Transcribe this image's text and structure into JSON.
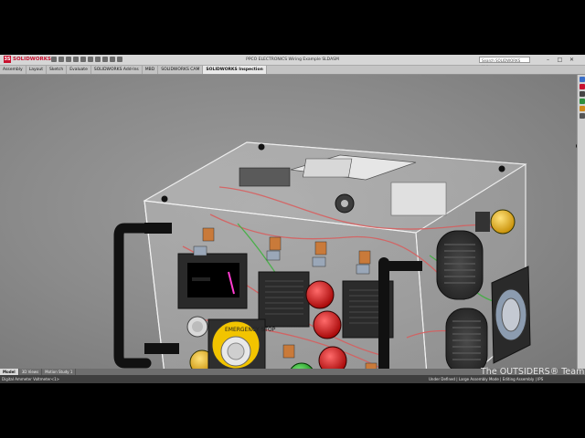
{
  "window": {
    "brand": "SOLIDWORKS",
    "title": "PPCO ELECTRONICS Wiring Example SLDASM",
    "search_placeholder": "Search SOLIDWORKS Help",
    "controls": [
      "–",
      "□",
      "✕"
    ]
  },
  "command_tabs": [
    "Assembly",
    "Layout",
    "Sketch",
    "Evaluate",
    "SOLIDWORKS Add-Ins",
    "MBD",
    "SOLIDWORKS CAM",
    "SOLIDWORKS Inspection"
  ],
  "active_command_tab": "SOLIDWORKS Inspection",
  "model_tabs": [
    "Model",
    "3D Views",
    "Motion Study 1"
  ],
  "active_model_tab": "Model",
  "status": {
    "left": "Digital Ammeter Voltmeter<1>",
    "right": "Under Defined  |  Large Assembly Mode  |  Editing Assembly  |  IPS"
  },
  "panel_labels": {
    "estop": "EMERGENCY STOP",
    "lamp_ring": "L· MODE"
  },
  "watermark": "The OUTSIDERS® Team",
  "colors": {
    "accent_red": "#c8102e",
    "button_red": "#d81818",
    "button_green": "#1ea81e",
    "button_yellow": "#f2b705",
    "button_blue": "#1433c8",
    "wire_red": "#d95a5a",
    "wire_green": "#39b039"
  },
  "icons": [
    "solidworks-logo-icon",
    "new-doc-icon",
    "open-icon",
    "save-icon",
    "print-icon",
    "undo-icon",
    "rebuild-icon",
    "options-icon",
    "search-icon",
    "view-triad-icon"
  ]
}
